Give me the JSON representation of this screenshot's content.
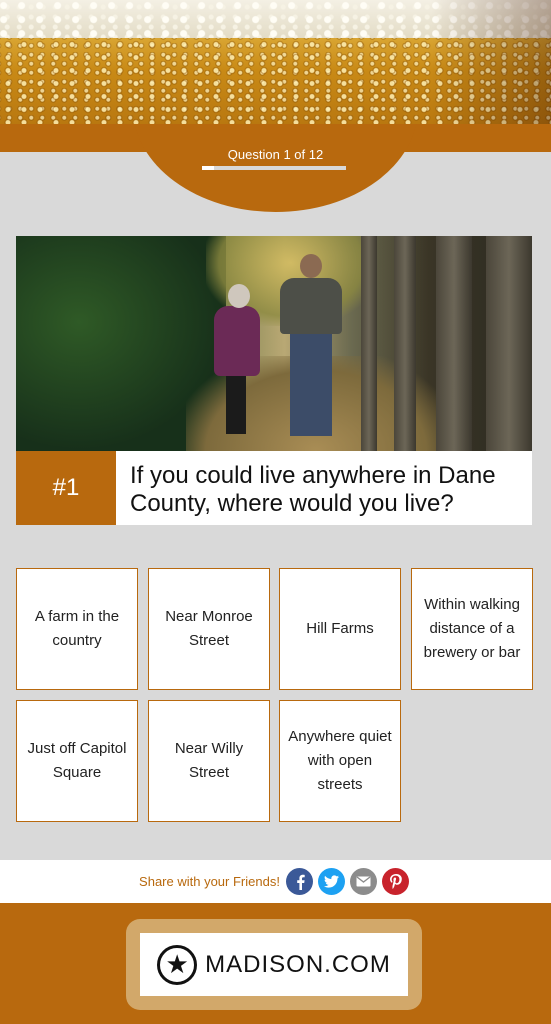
{
  "header": {
    "question_counter": "Question 1 of 12",
    "progress": {
      "current": 1,
      "total": 12
    }
  },
  "question": {
    "number_label": "#1",
    "text": "If you could live anywhere in Dane County, where would you live?"
  },
  "answers": [
    "A farm in the country",
    "Near Monroe Street",
    "Hill Farms",
    "Within walking distance of a brewery or bar",
    "Just off Capitol Square",
    "Near Willy Street",
    "Anywhere quiet with open streets"
  ],
  "share": {
    "label": "Share with your Friends!",
    "icons": [
      "facebook-icon",
      "twitter-icon",
      "email-icon",
      "pinterest-icon"
    ],
    "colors": {
      "facebook": "#3b5998",
      "twitter": "#1da1f2",
      "email": "#8c8c8c",
      "pinterest": "#c8232c"
    }
  },
  "footer": {
    "logo_text": "MADISON.COM"
  },
  "colors": {
    "accent": "#b8690e",
    "panel_bg": "#d9d9d9"
  }
}
